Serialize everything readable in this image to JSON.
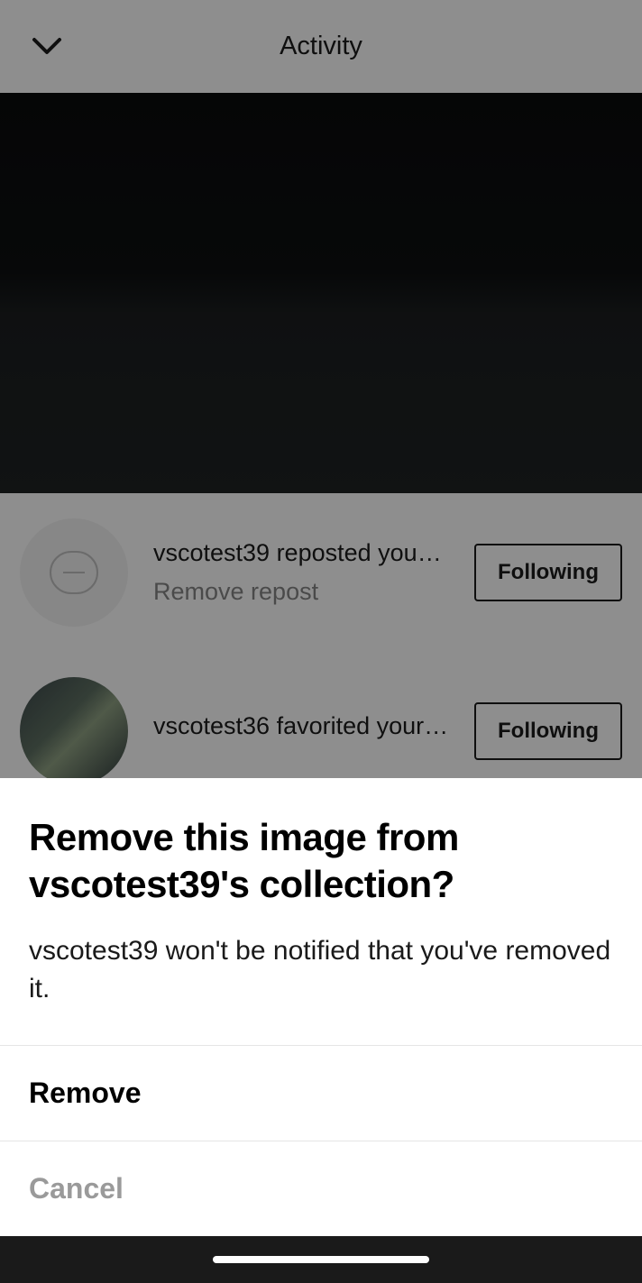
{
  "header": {
    "title": "Activity"
  },
  "activity_items": [
    {
      "main_text": "vscotest39 reposted your ima...",
      "sub_text": "Remove repost",
      "button_label": "Following"
    },
    {
      "main_text": "vscotest36 favorited your ima...",
      "button_label": "Following"
    }
  ],
  "sheet": {
    "title": "Remove this image from vscotest39's collection?",
    "body": "vscotest39 won't be notified that you've removed it.",
    "remove_label": "Remove",
    "cancel_label": "Cancel"
  }
}
